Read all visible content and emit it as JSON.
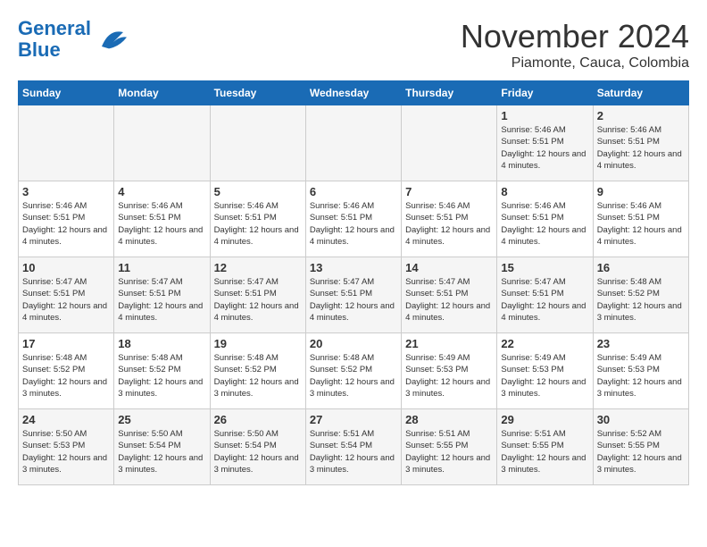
{
  "header": {
    "logo_line1": "General",
    "logo_line2": "Blue",
    "month": "November 2024",
    "location": "Piamonte, Cauca, Colombia"
  },
  "days_of_week": [
    "Sunday",
    "Monday",
    "Tuesday",
    "Wednesday",
    "Thursday",
    "Friday",
    "Saturday"
  ],
  "weeks": [
    [
      {
        "day": "",
        "info": ""
      },
      {
        "day": "",
        "info": ""
      },
      {
        "day": "",
        "info": ""
      },
      {
        "day": "",
        "info": ""
      },
      {
        "day": "",
        "info": ""
      },
      {
        "day": "1",
        "info": "Sunrise: 5:46 AM\nSunset: 5:51 PM\nDaylight: 12 hours and 4 minutes."
      },
      {
        "day": "2",
        "info": "Sunrise: 5:46 AM\nSunset: 5:51 PM\nDaylight: 12 hours and 4 minutes."
      }
    ],
    [
      {
        "day": "3",
        "info": "Sunrise: 5:46 AM\nSunset: 5:51 PM\nDaylight: 12 hours and 4 minutes."
      },
      {
        "day": "4",
        "info": "Sunrise: 5:46 AM\nSunset: 5:51 PM\nDaylight: 12 hours and 4 minutes."
      },
      {
        "day": "5",
        "info": "Sunrise: 5:46 AM\nSunset: 5:51 PM\nDaylight: 12 hours and 4 minutes."
      },
      {
        "day": "6",
        "info": "Sunrise: 5:46 AM\nSunset: 5:51 PM\nDaylight: 12 hours and 4 minutes."
      },
      {
        "day": "7",
        "info": "Sunrise: 5:46 AM\nSunset: 5:51 PM\nDaylight: 12 hours and 4 minutes."
      },
      {
        "day": "8",
        "info": "Sunrise: 5:46 AM\nSunset: 5:51 PM\nDaylight: 12 hours and 4 minutes."
      },
      {
        "day": "9",
        "info": "Sunrise: 5:46 AM\nSunset: 5:51 PM\nDaylight: 12 hours and 4 minutes."
      }
    ],
    [
      {
        "day": "10",
        "info": "Sunrise: 5:47 AM\nSunset: 5:51 PM\nDaylight: 12 hours and 4 minutes."
      },
      {
        "day": "11",
        "info": "Sunrise: 5:47 AM\nSunset: 5:51 PM\nDaylight: 12 hours and 4 minutes."
      },
      {
        "day": "12",
        "info": "Sunrise: 5:47 AM\nSunset: 5:51 PM\nDaylight: 12 hours and 4 minutes."
      },
      {
        "day": "13",
        "info": "Sunrise: 5:47 AM\nSunset: 5:51 PM\nDaylight: 12 hours and 4 minutes."
      },
      {
        "day": "14",
        "info": "Sunrise: 5:47 AM\nSunset: 5:51 PM\nDaylight: 12 hours and 4 minutes."
      },
      {
        "day": "15",
        "info": "Sunrise: 5:47 AM\nSunset: 5:51 PM\nDaylight: 12 hours and 4 minutes."
      },
      {
        "day": "16",
        "info": "Sunrise: 5:48 AM\nSunset: 5:52 PM\nDaylight: 12 hours and 3 minutes."
      }
    ],
    [
      {
        "day": "17",
        "info": "Sunrise: 5:48 AM\nSunset: 5:52 PM\nDaylight: 12 hours and 3 minutes."
      },
      {
        "day": "18",
        "info": "Sunrise: 5:48 AM\nSunset: 5:52 PM\nDaylight: 12 hours and 3 minutes."
      },
      {
        "day": "19",
        "info": "Sunrise: 5:48 AM\nSunset: 5:52 PM\nDaylight: 12 hours and 3 minutes."
      },
      {
        "day": "20",
        "info": "Sunrise: 5:48 AM\nSunset: 5:52 PM\nDaylight: 12 hours and 3 minutes."
      },
      {
        "day": "21",
        "info": "Sunrise: 5:49 AM\nSunset: 5:53 PM\nDaylight: 12 hours and 3 minutes."
      },
      {
        "day": "22",
        "info": "Sunrise: 5:49 AM\nSunset: 5:53 PM\nDaylight: 12 hours and 3 minutes."
      },
      {
        "day": "23",
        "info": "Sunrise: 5:49 AM\nSunset: 5:53 PM\nDaylight: 12 hours and 3 minutes."
      }
    ],
    [
      {
        "day": "24",
        "info": "Sunrise: 5:50 AM\nSunset: 5:53 PM\nDaylight: 12 hours and 3 minutes."
      },
      {
        "day": "25",
        "info": "Sunrise: 5:50 AM\nSunset: 5:54 PM\nDaylight: 12 hours and 3 minutes."
      },
      {
        "day": "26",
        "info": "Sunrise: 5:50 AM\nSunset: 5:54 PM\nDaylight: 12 hours and 3 minutes."
      },
      {
        "day": "27",
        "info": "Sunrise: 5:51 AM\nSunset: 5:54 PM\nDaylight: 12 hours and 3 minutes."
      },
      {
        "day": "28",
        "info": "Sunrise: 5:51 AM\nSunset: 5:55 PM\nDaylight: 12 hours and 3 minutes."
      },
      {
        "day": "29",
        "info": "Sunrise: 5:51 AM\nSunset: 5:55 PM\nDaylight: 12 hours and 3 minutes."
      },
      {
        "day": "30",
        "info": "Sunrise: 5:52 AM\nSunset: 5:55 PM\nDaylight: 12 hours and 3 minutes."
      }
    ]
  ]
}
